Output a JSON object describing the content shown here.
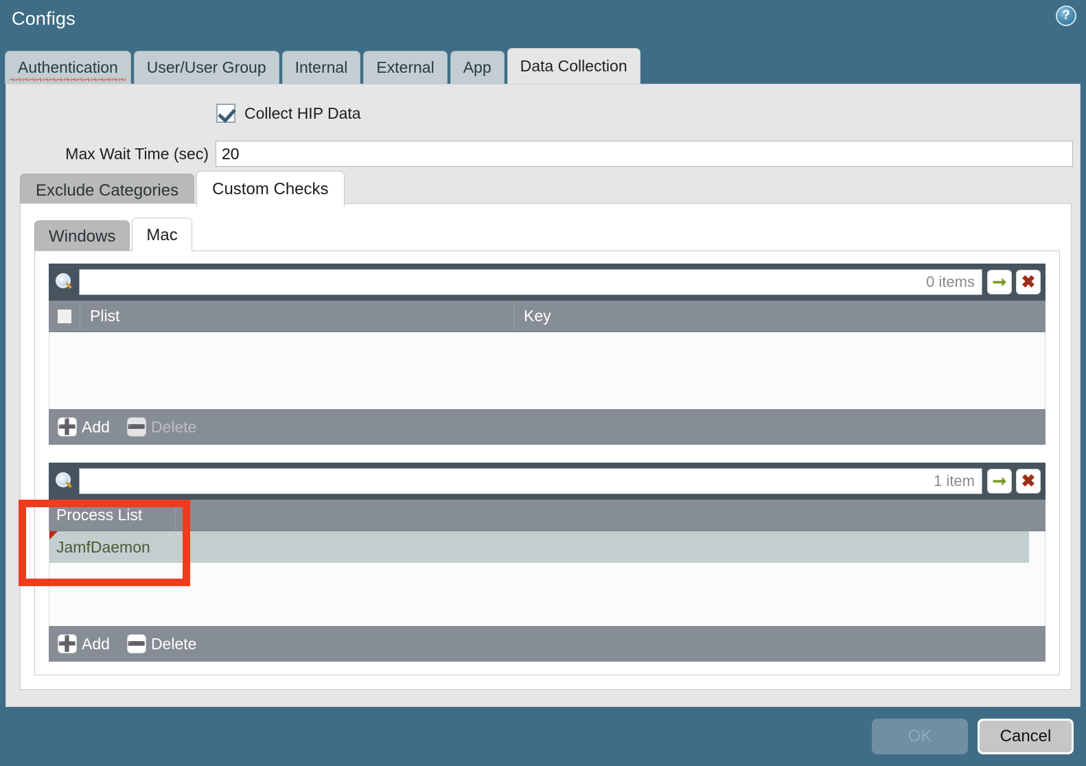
{
  "dialog": {
    "title": "Configs",
    "help_icon": "?"
  },
  "tabs": [
    {
      "label": "Authentication",
      "active": false,
      "spellcheck_underline": true
    },
    {
      "label": "User/User Group",
      "active": false
    },
    {
      "label": "Internal",
      "active": false
    },
    {
      "label": "External",
      "active": false
    },
    {
      "label": "App",
      "active": false
    },
    {
      "label": "Data Collection",
      "active": true
    }
  ],
  "form": {
    "collect_hip_label": "Collect HIP Data",
    "collect_hip_checked": true,
    "max_wait_label": "Max Wait Time (sec)",
    "max_wait_value": "20",
    "max_wait_placeholder": ""
  },
  "subtabs": [
    {
      "label": "Exclude Categories",
      "active": false
    },
    {
      "label": "Custom Checks",
      "active": true
    }
  ],
  "innertabs": [
    {
      "label": "Windows",
      "active": false
    },
    {
      "label": "Mac",
      "active": true
    }
  ],
  "grids": [
    {
      "name": "plist-grid",
      "search_value": "",
      "search_placeholder": "",
      "count_label": "0 items",
      "go_icon": "arrow-right-icon",
      "clear_icon": "clear-x-icon",
      "columns": [
        "Plist",
        "Key"
      ],
      "rows": [],
      "add_label": "Add",
      "delete_label": "Delete",
      "delete_enabled": false
    },
    {
      "name": "process-list-grid",
      "search_value": "",
      "search_placeholder": "",
      "count_label": "1 item",
      "go_icon": "arrow-right-icon",
      "clear_icon": "clear-x-icon",
      "columns": [
        "Process List"
      ],
      "rows": [
        {
          "value": "JamfDaemon",
          "selected": true,
          "edited": true
        }
      ],
      "add_label": "Add",
      "delete_label": "Delete",
      "delete_enabled": true
    }
  ],
  "footer": {
    "ok_label": "OK",
    "ok_enabled": false,
    "cancel_label": "Cancel"
  },
  "annotation": {
    "color": "#f03c1e",
    "shape": "rectangle"
  },
  "colors": {
    "dialog_chrome": "#3f6d86",
    "panel": "#e6e6e6",
    "grid_header": "#868d95",
    "grid_search_bar": "#47545e",
    "selected_row": "#c3cfcf",
    "row_text": "#4a5a33",
    "annotation": "#f03c1e"
  }
}
